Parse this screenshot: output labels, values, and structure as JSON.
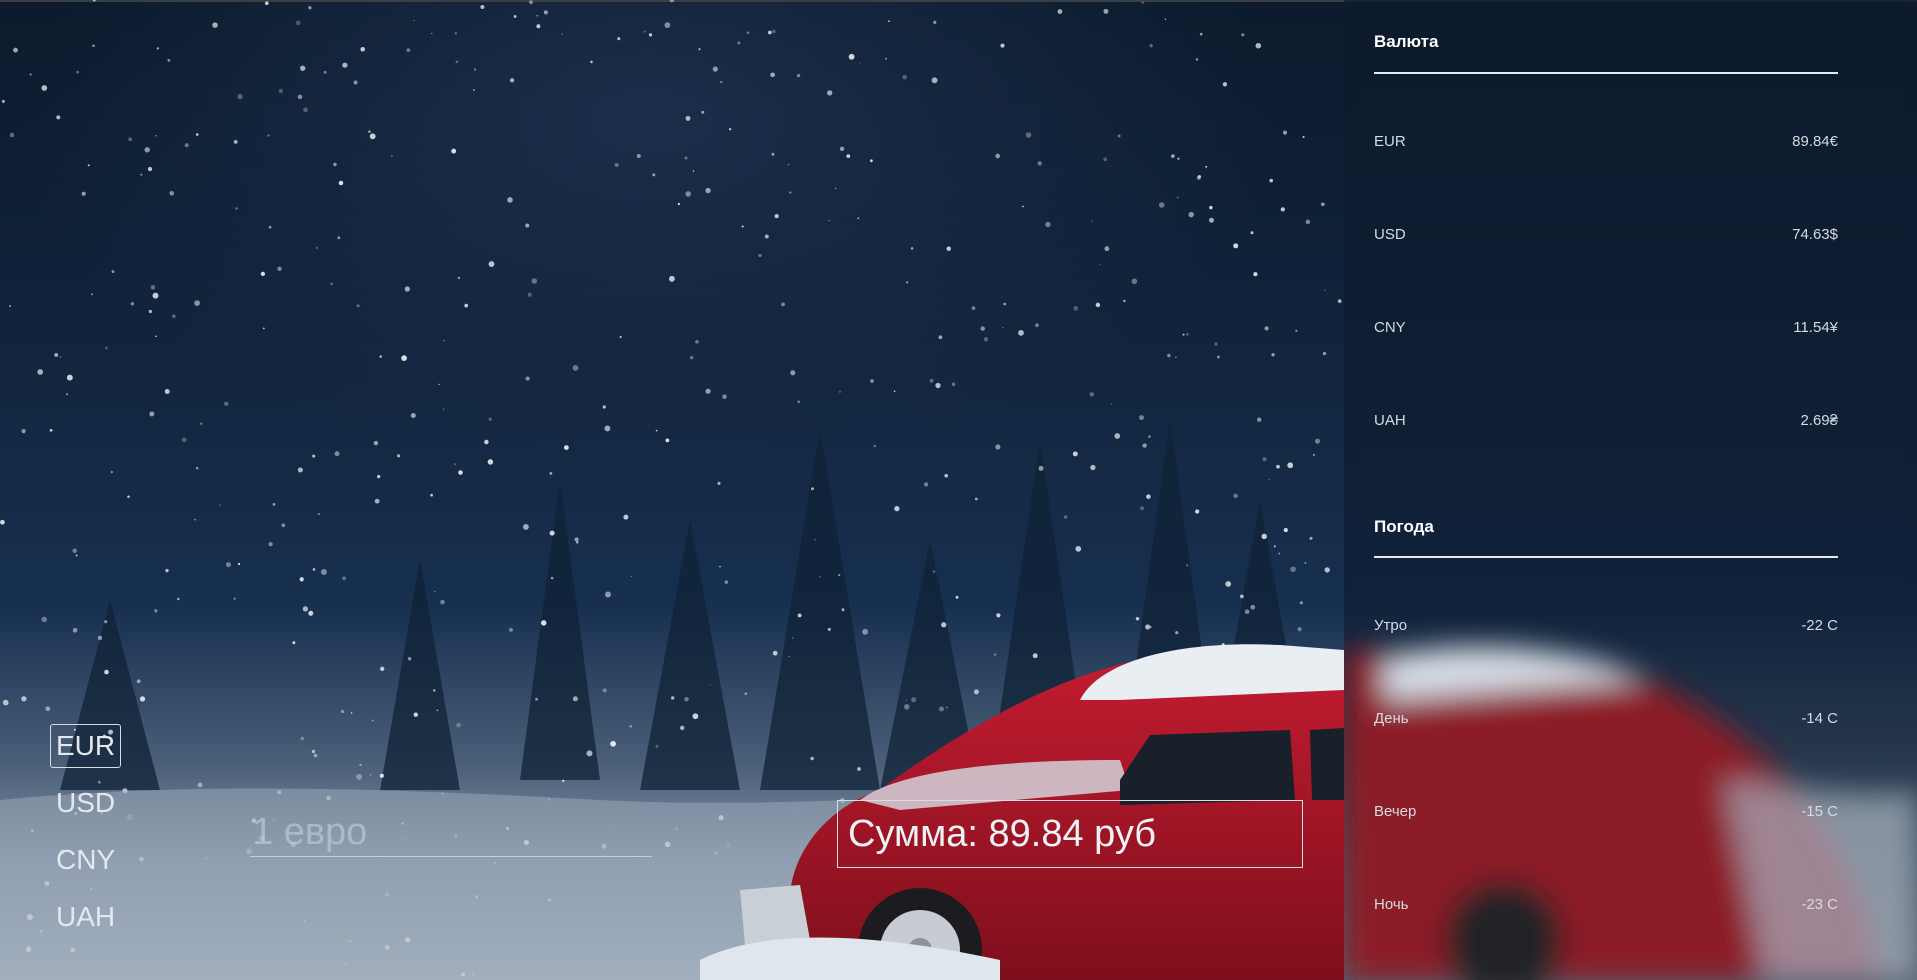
{
  "currency_panel": {
    "title": "Валюта",
    "rates": [
      {
        "code": "EUR",
        "value": "89.84€"
      },
      {
        "code": "USD",
        "value": "74.63$"
      },
      {
        "code": "CNY",
        "value": "11.54¥"
      },
      {
        "code": "UAH",
        "value": "2.69₴"
      }
    ]
  },
  "weather_panel": {
    "title": "Погода",
    "items": [
      {
        "label": "Утро",
        "value": "-22 C"
      },
      {
        "label": "День",
        "value": "-14 C"
      },
      {
        "label": "Вечер",
        "value": "-15 C"
      },
      {
        "label": "Ночь",
        "value": "-23 C"
      }
    ]
  },
  "converter": {
    "currencies": [
      "EUR",
      "USD",
      "CNY",
      "UAH"
    ],
    "selected": "EUR",
    "input_placeholder": "1 евро",
    "input_value": "",
    "result": "Сумма: 89.84 руб"
  },
  "colors": {
    "sky": "#12263f",
    "snow": "#aab6c4",
    "car_red": "#b0182a"
  },
  "icons": {
    "background": "snowy-night-car-photo"
  }
}
